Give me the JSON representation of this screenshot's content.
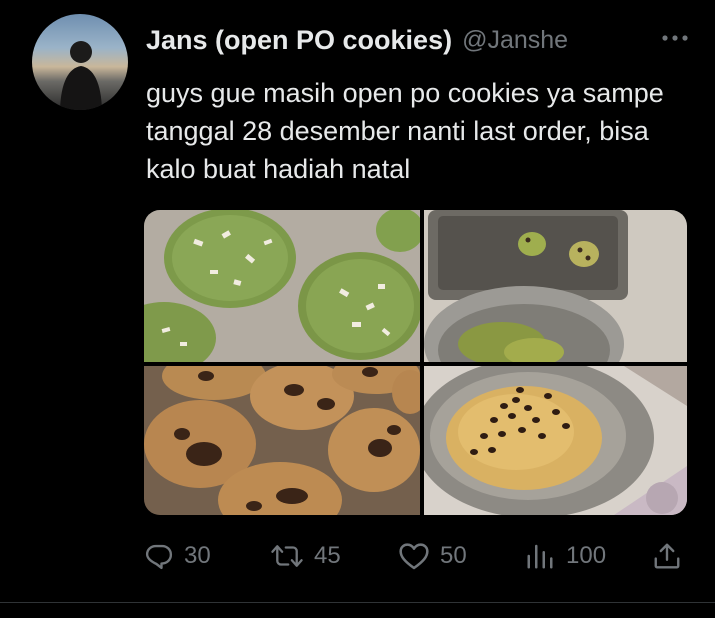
{
  "user": {
    "display_name": "Jans (open PO cookies)",
    "handle": "@Janshe",
    "avatar_icon": "profile-photo"
  },
  "tweet": {
    "text": "guys gue masih open po cookies ya sampe tanggal 28 desember nanti last order, bisa kalo buat hadiah natal",
    "media": [
      {
        "name": "matcha-cookies-photo",
        "description_icon": "image"
      },
      {
        "name": "baking-tray-bowl-photo",
        "description_icon": "image"
      },
      {
        "name": "chocolate-chip-cookies-photo",
        "description_icon": "image"
      },
      {
        "name": "cookie-dough-photo",
        "description_icon": "image"
      }
    ]
  },
  "actions": {
    "reply": {
      "icon": "reply-icon",
      "count": "30"
    },
    "retweet": {
      "icon": "retweet-icon",
      "count": "45"
    },
    "like": {
      "icon": "heart-icon",
      "count": "50"
    },
    "views": {
      "icon": "views-icon",
      "count": "100"
    },
    "share": {
      "icon": "share-icon"
    }
  },
  "colors": {
    "background": "#000000",
    "text_primary": "#e7e9ea",
    "text_secondary": "#71767b",
    "divider": "#2f3336"
  }
}
